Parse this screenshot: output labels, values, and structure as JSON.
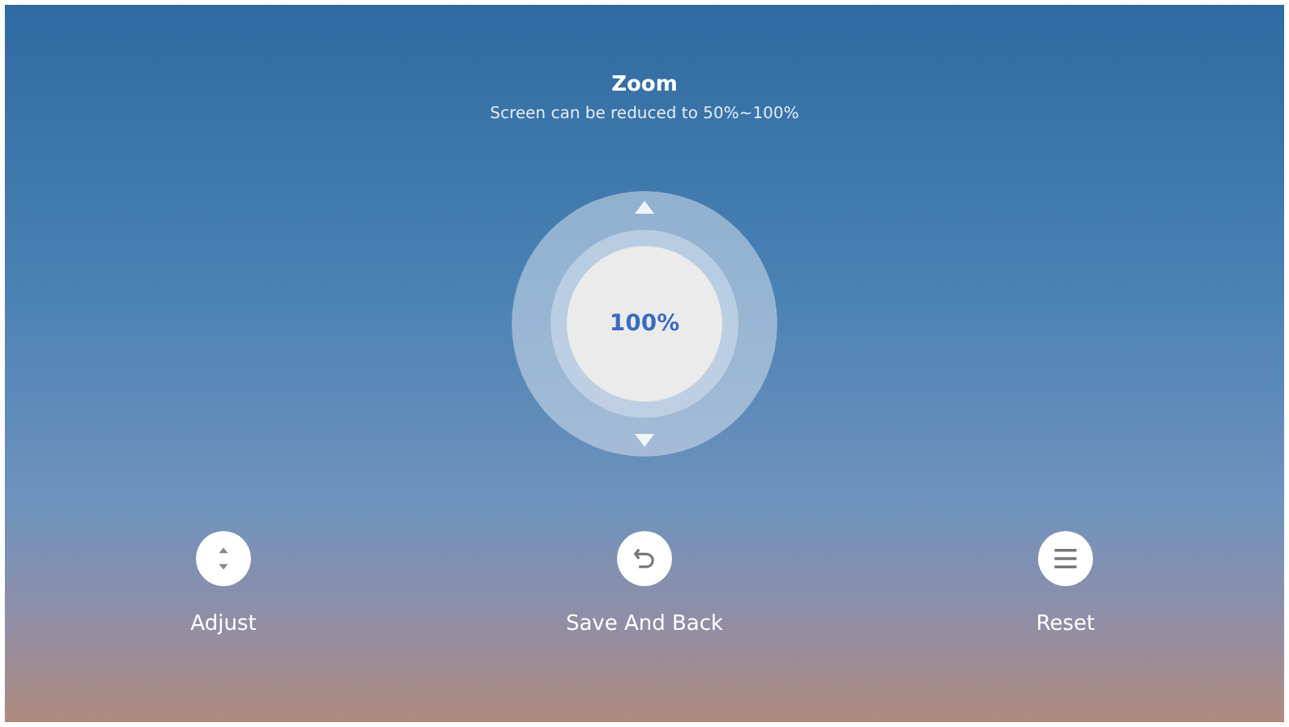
{
  "header": {
    "title": "Zoom",
    "subtitle": "Screen can be reduced to 50%~100%"
  },
  "dial": {
    "value": "100%"
  },
  "actions": [
    {
      "kind": "adjust",
      "label": "Adjust"
    },
    {
      "kind": "back",
      "label": "Save And Back"
    },
    {
      "kind": "menu",
      "label": "Reset"
    }
  ]
}
